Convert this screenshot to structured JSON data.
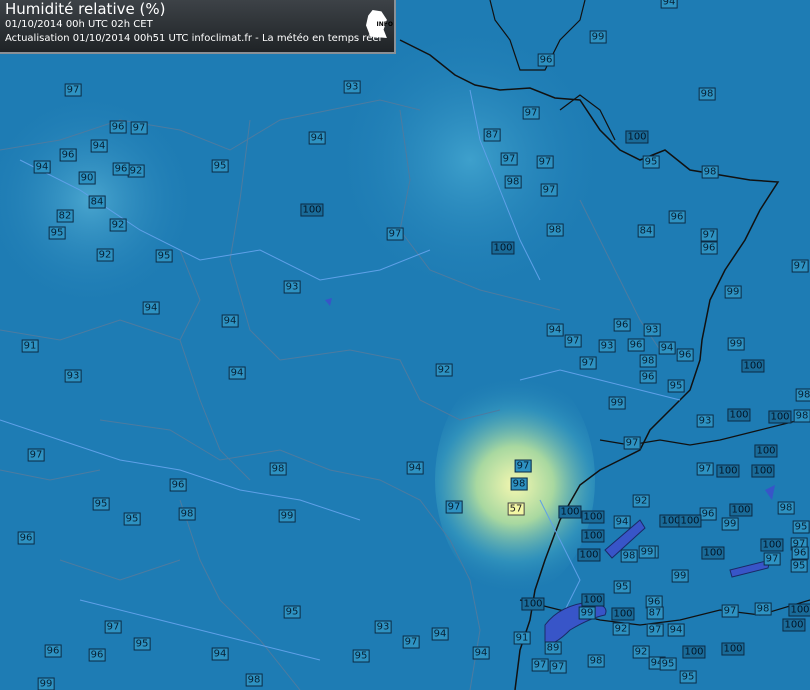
{
  "header": {
    "title": "Humidité relative (%)",
    "run_line": "01/10/2014  00h UTC  02h CET",
    "update_line": "Actualisation 01/10/2014 00h51 UTC   infoclimat.fr - La météo en temps réel",
    "logo": "infoclimat-logo"
  },
  "colors": {
    "ocean_blue": "#1e7cb4",
    "dry_highlight": "#f4f7b0",
    "label_bg": "#2e92c2",
    "border": "#0b2a44"
  },
  "stations": [
    {
      "v": "94"
    },
    {
      "v": "99"
    },
    {
      "v": "96"
    },
    {
      "v": "97"
    },
    {
      "v": "93"
    },
    {
      "v": "98"
    },
    {
      "v": "96"
    },
    {
      "v": "97"
    },
    {
      "v": "96"
    },
    {
      "v": "94"
    },
    {
      "v": "92"
    },
    {
      "v": "96"
    },
    {
      "v": "90"
    },
    {
      "v": "96"
    },
    {
      "v": "94"
    },
    {
      "v": "95"
    },
    {
      "v": "84"
    },
    {
      "v": "82"
    },
    {
      "v": "95"
    },
    {
      "v": "92"
    },
    {
      "v": "92"
    },
    {
      "v": "95"
    },
    {
      "v": "100"
    },
    {
      "v": "97"
    },
    {
      "v": "93"
    },
    {
      "v": "94"
    },
    {
      "v": "94"
    },
    {
      "v": "91"
    },
    {
      "v": "93"
    },
    {
      "v": "94"
    },
    {
      "v": "92"
    },
    {
      "v": "94"
    },
    {
      "v": "97"
    },
    {
      "v": "98"
    },
    {
      "v": "96"
    },
    {
      "v": "95"
    },
    {
      "v": "95"
    },
    {
      "v": "98"
    },
    {
      "v": "99"
    },
    {
      "v": "96"
    },
    {
      "v": "97"
    },
    {
      "v": "94"
    },
    {
      "v": "87"
    },
    {
      "v": "97"
    },
    {
      "v": "97"
    },
    {
      "v": "98"
    },
    {
      "v": "97"
    },
    {
      "v": "98"
    },
    {
      "v": "100"
    },
    {
      "v": "100"
    },
    {
      "v": "95"
    },
    {
      "v": "98"
    },
    {
      "v": "96"
    },
    {
      "v": "84"
    },
    {
      "v": "97"
    },
    {
      "v": "96"
    },
    {
      "v": "97"
    },
    {
      "v": "99"
    },
    {
      "v": "94"
    },
    {
      "v": "97"
    },
    {
      "v": "97"
    },
    {
      "v": "96"
    },
    {
      "v": "93"
    },
    {
      "v": "93"
    },
    {
      "v": "96"
    },
    {
      "v": "94"
    },
    {
      "v": "98"
    },
    {
      "v": "96"
    },
    {
      "v": "96"
    },
    {
      "v": "95"
    },
    {
      "v": "99"
    },
    {
      "v": "100"
    },
    {
      "v": "97"
    },
    {
      "v": "99"
    },
    {
      "v": "98"
    },
    {
      "v": "93"
    },
    {
      "v": "100"
    },
    {
      "v": "100"
    },
    {
      "v": "98"
    },
    {
      "v": "97"
    },
    {
      "v": "97"
    },
    {
      "v": "98"
    },
    {
      "v": "57"
    },
    {
      "v": "100"
    },
    {
      "v": "100"
    },
    {
      "v": "94"
    },
    {
      "v": "92"
    },
    {
      "v": "100"
    },
    {
      "v": "99"
    },
    {
      "v": "100"
    },
    {
      "v": "97"
    },
    {
      "v": "100"
    },
    {
      "v": "100"
    },
    {
      "v": "100"
    },
    {
      "v": "96"
    },
    {
      "v": "100"
    },
    {
      "v": "99"
    },
    {
      "v": "100"
    },
    {
      "v": "98"
    },
    {
      "v": "100"
    },
    {
      "v": "95"
    },
    {
      "v": "98"
    },
    {
      "v": "99"
    },
    {
      "v": "100"
    },
    {
      "v": "100"
    },
    {
      "v": "97"
    },
    {
      "v": "97"
    },
    {
      "v": "96"
    },
    {
      "v": "95"
    },
    {
      "v": "99"
    },
    {
      "v": "100"
    },
    {
      "v": "95"
    },
    {
      "v": "96"
    },
    {
      "v": "100"
    },
    {
      "v": "99"
    },
    {
      "v": "92"
    },
    {
      "v": "87"
    },
    {
      "v": "97"
    },
    {
      "v": "94"
    },
    {
      "v": "97"
    },
    {
      "v": "92"
    },
    {
      "v": "94"
    },
    {
      "v": "100"
    },
    {
      "v": "100"
    },
    {
      "v": "98"
    },
    {
      "v": "100"
    },
    {
      "v": "100"
    },
    {
      "v": "89"
    },
    {
      "v": "97"
    },
    {
      "v": "97"
    },
    {
      "v": "98"
    },
    {
      "v": "100"
    },
    {
      "v": "95"
    },
    {
      "v": "95"
    },
    {
      "v": "94"
    },
    {
      "v": "95"
    },
    {
      "v": "91"
    },
    {
      "v": "93"
    },
    {
      "v": "94"
    },
    {
      "v": "95"
    },
    {
      "v": "94"
    },
    {
      "v": "96"
    },
    {
      "v": "95"
    },
    {
      "v": "97"
    },
    {
      "v": "99"
    },
    {
      "v": "98"
    },
    {
      "v": "97"
    },
    {
      "v": "96"
    }
  ]
}
